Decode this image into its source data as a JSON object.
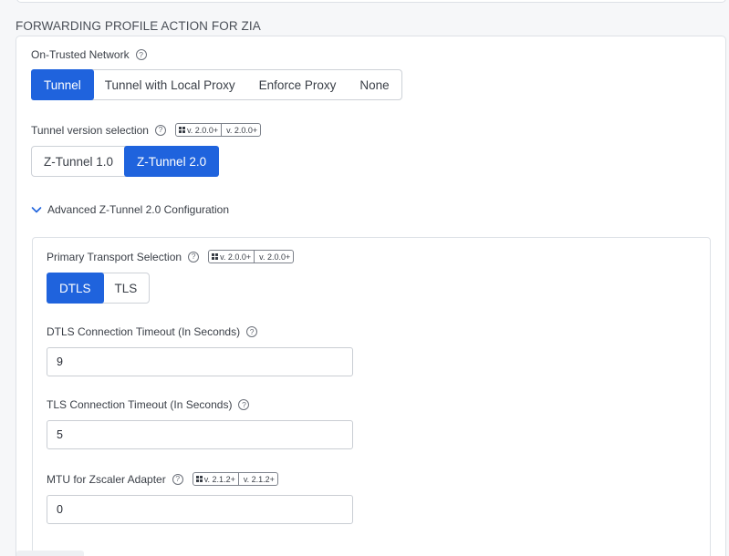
{
  "section_title": "FORWARDING PROFILE ACTION FOR ZIA",
  "on_trusted": {
    "label": "On-Trusted Network",
    "options": [
      "Tunnel",
      "Tunnel with Local Proxy",
      "Enforce Proxy",
      "None"
    ],
    "selected": "Tunnel"
  },
  "tunnel_version": {
    "label": "Tunnel version selection",
    "badges": {
      "windows": "v. 2.0.0+",
      "apple": "v. 2.0.0+"
    },
    "options": [
      "Z-Tunnel 1.0",
      "Z-Tunnel 2.0"
    ],
    "selected": "Z-Tunnel 2.0"
  },
  "advanced": {
    "label": "Advanced Z-Tunnel 2.0 Configuration",
    "expanded": true
  },
  "primary_transport": {
    "label": "Primary Transport Selection",
    "badges": {
      "windows": "v. 2.0.0+",
      "apple": "v. 2.0.0+"
    },
    "options": [
      "DTLS",
      "TLS"
    ],
    "selected": "DTLS"
  },
  "dtls_timeout": {
    "label": "DTLS Connection Timeout (In Seconds)",
    "value": "9"
  },
  "tls_timeout": {
    "label": "TLS Connection Timeout (In Seconds)",
    "value": "5"
  },
  "mtu": {
    "label": "MTU for Zscaler Adapter",
    "badges": {
      "windows": "v. 2.1.2+",
      "apple": "v. 2.1.2+"
    },
    "value": "0"
  },
  "help_glyph": "?",
  "apple_glyph": "",
  "colors": {
    "accent": "#1f63dd",
    "border": "#dde1e6"
  }
}
